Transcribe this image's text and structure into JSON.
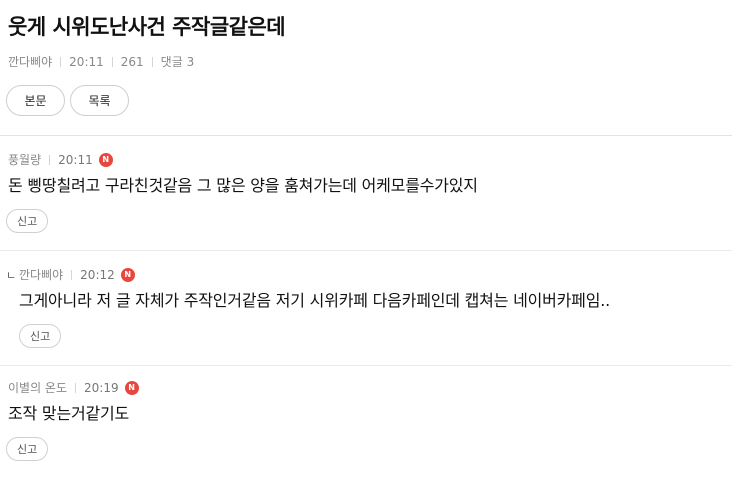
{
  "post": {
    "title": "웃게 시위도난사건 주작글같은데",
    "author": "깐다삐야",
    "time": "20:11",
    "views": "261",
    "comment_count": "댓글 3",
    "buttons": {
      "body": "본문",
      "list": "목록"
    }
  },
  "comments": [
    {
      "author": "풍월량",
      "time": "20:11",
      "badge": "N",
      "text": "돈 삥땅칠려고 구라친것같음 그 많은 양을 훔쳐가는데 어케모를수가있지",
      "report": "신고"
    },
    {
      "reply_mark": "ㄴ",
      "author": "깐다삐야",
      "time": "20:12",
      "badge": "N",
      "text": "그게아니라 저 글 자체가 주작인거같음 저기 시위카페 다음카페인데 캡쳐는 네이버카페임..",
      "report": "신고"
    },
    {
      "author": "이별의 온도",
      "time": "20:19",
      "badge": "N",
      "text": "조작 맞는거같기도",
      "report": "신고"
    }
  ],
  "colors": {
    "badge": "#e8473f",
    "meta": "#888888",
    "divider": "#e3e3e3"
  }
}
